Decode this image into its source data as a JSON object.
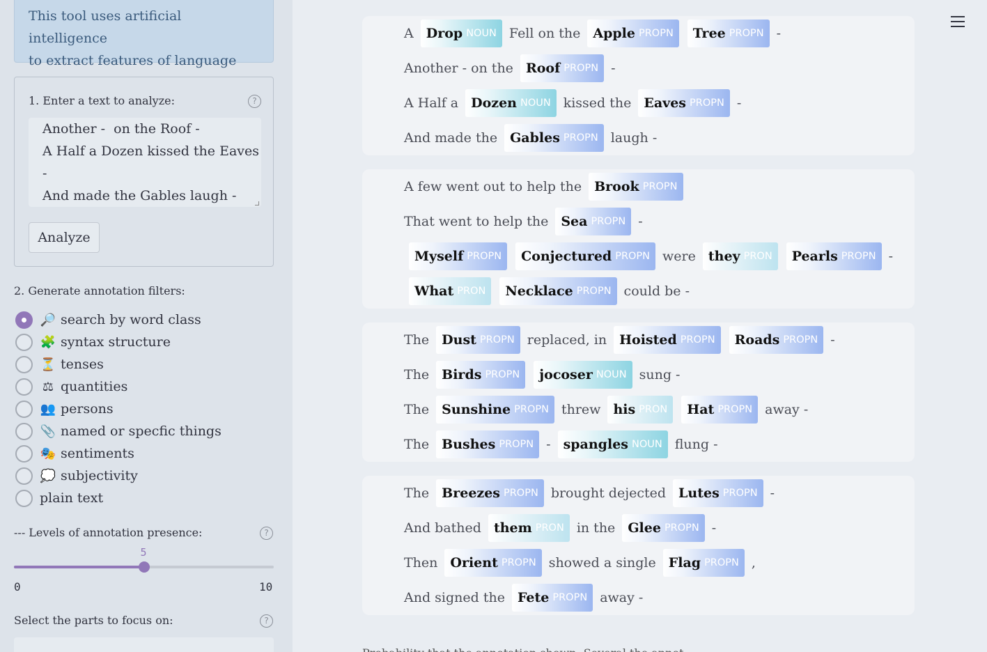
{
  "sidebar": {
    "info_text": "This tool uses artificial intelligence to extract features of language",
    "info_line1": "This tool uses artificial intelligence",
    "info_line2": "to extract features of language",
    "input_label": "1. Enter a text to analyze:",
    "textarea_value": "Another -  on the Roof -\nA Half a Dozen kissed the Eaves\n-\nAnd made the Gables laugh -",
    "analyze_label": "Analyze",
    "filters_label": "2. Generate annotation filters:",
    "options": [
      {
        "icon": "magnifier-icon",
        "glyph": "🔎",
        "label": "search by word class",
        "checked": true
      },
      {
        "icon": "puzzle-icon",
        "glyph": "🧩",
        "label": "syntax structure",
        "checked": false
      },
      {
        "icon": "hourglass-icon",
        "glyph": "⏳",
        "label": "tenses",
        "checked": false
      },
      {
        "icon": "scales-icon",
        "glyph": "⚖",
        "label": "quantities",
        "checked": false
      },
      {
        "icon": "people-icon",
        "glyph": "👥",
        "label": "persons",
        "checked": false
      },
      {
        "icon": "paperclip-icon",
        "glyph": "📎",
        "label": "named or specfic things",
        "checked": false
      },
      {
        "icon": "masks-icon",
        "glyph": "🎭",
        "label": "sentiments",
        "checked": false
      },
      {
        "icon": "speech-bubble-icon",
        "glyph": "💭",
        "label": "subjectivity",
        "checked": false
      },
      {
        "icon": "",
        "glyph": "",
        "label": "plain text",
        "checked": false
      }
    ],
    "levels_label": "--- Levels of annotation presence:",
    "slider": {
      "value": 5,
      "min": 0,
      "max": 10,
      "value_label": "5",
      "min_label": "0",
      "max_label": "10"
    },
    "focus_label": "Select the parts to focus on:",
    "accent_color": "#9177b8"
  },
  "stanzas": [
    {
      "lines": [
        [
          {
            "t": "A"
          },
          {
            "w": "Drop",
            "tag": "NOUN"
          },
          {
            "t": "Fell on the"
          },
          {
            "w": "Apple",
            "tag": "PROPN"
          },
          {
            "w": "Tree",
            "tag": "PROPN"
          },
          {
            "t": "-"
          }
        ],
        [
          {
            "t": "Another - on the"
          },
          {
            "w": "Roof",
            "tag": "PROPN"
          },
          {
            "t": "-"
          }
        ],
        [
          {
            "t": "A Half a"
          },
          {
            "w": "Dozen",
            "tag": "NOUN"
          },
          {
            "t": "kissed the"
          },
          {
            "w": "Eaves",
            "tag": "PROPN"
          },
          {
            "t": "-"
          }
        ],
        [
          {
            "t": "And made the"
          },
          {
            "w": "Gables",
            "tag": "PROPN"
          },
          {
            "t": "laugh -"
          }
        ]
      ]
    },
    {
      "lines": [
        [
          {
            "t": "A few went out to help the"
          },
          {
            "w": "Brook",
            "tag": "PROPN"
          }
        ],
        [
          {
            "t": "That went to help the"
          },
          {
            "w": "Sea",
            "tag": "PROPN"
          },
          {
            "t": "-"
          }
        ],
        [
          {
            "w": "Myself",
            "tag": "PROPN"
          },
          {
            "w": "Conjectured",
            "tag": "PROPN"
          },
          {
            "t": "were"
          },
          {
            "w": "they",
            "tag": "PRON"
          },
          {
            "w": "Pearls",
            "tag": "PROPN"
          },
          {
            "t": "-"
          }
        ],
        [
          {
            "w": "What",
            "tag": "PRON"
          },
          {
            "w": "Necklace",
            "tag": "PROPN"
          },
          {
            "t": "could be -"
          }
        ]
      ]
    },
    {
      "lines": [
        [
          {
            "t": "The"
          },
          {
            "w": "Dust",
            "tag": "PROPN"
          },
          {
            "t": "replaced, in"
          },
          {
            "w": "Hoisted",
            "tag": "PROPN"
          },
          {
            "w": "Roads",
            "tag": "PROPN"
          },
          {
            "t": "-"
          }
        ],
        [
          {
            "t": "The"
          },
          {
            "w": "Birds",
            "tag": "PROPN"
          },
          {
            "w": "jocoser",
            "tag": "NOUN"
          },
          {
            "t": "sung -"
          }
        ],
        [
          {
            "t": "The"
          },
          {
            "w": "Sunshine",
            "tag": "PROPN"
          },
          {
            "t": "threw"
          },
          {
            "w": "his",
            "tag": "PRON"
          },
          {
            "w": "Hat",
            "tag": "PROPN"
          },
          {
            "t": "away -"
          }
        ],
        [
          {
            "t": "The"
          },
          {
            "w": "Bushes",
            "tag": "PROPN"
          },
          {
            "t": "-"
          },
          {
            "w": "spangles",
            "tag": "NOUN"
          },
          {
            "t": "flung -"
          }
        ]
      ]
    },
    {
      "lines": [
        [
          {
            "t": "The"
          },
          {
            "w": "Breezes",
            "tag": "PROPN"
          },
          {
            "t": "brought dejected"
          },
          {
            "w": "Lutes",
            "tag": "PROPN"
          },
          {
            "t": "-"
          }
        ],
        [
          {
            "t": "And bathed"
          },
          {
            "w": "them",
            "tag": "PRON"
          },
          {
            "t": "in the"
          },
          {
            "w": "Glee",
            "tag": "PROPN"
          },
          {
            "t": "-"
          }
        ],
        [
          {
            "t": "Then"
          },
          {
            "w": "Orient",
            "tag": "PROPN"
          },
          {
            "t": "showed a single"
          },
          {
            "w": "Flag",
            "tag": "PROPN"
          },
          {
            "t": ","
          }
        ],
        [
          {
            "t": "And signed the"
          },
          {
            "w": "Fete",
            "tag": "PROPN"
          },
          {
            "t": "away -"
          }
        ]
      ]
    }
  ],
  "footer_text": "Probability that the annotation shown. Several the annot..."
}
